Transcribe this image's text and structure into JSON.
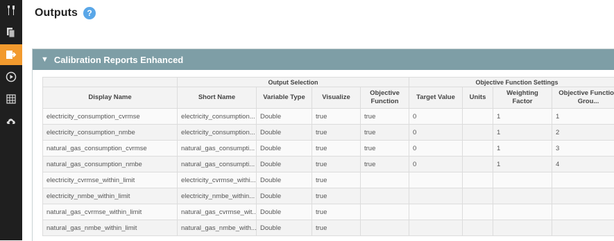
{
  "page": {
    "title": "Outputs",
    "help_icon": "?"
  },
  "sidebar": {
    "items": [
      {
        "icon": "tools-icon",
        "active": false
      },
      {
        "icon": "files-icon",
        "active": false
      },
      {
        "icon": "export-icon",
        "active": true
      },
      {
        "icon": "play-icon",
        "active": false
      },
      {
        "icon": "grid-icon",
        "active": false
      },
      {
        "icon": "cloud-icon",
        "active": false
      }
    ]
  },
  "panel": {
    "title": "Calibration Reports Enhanced",
    "group_output_selection": "Output Selection",
    "group_objective_settings": "Objective Function Settings",
    "columns": [
      "Display Name",
      "Short Name",
      "Variable Type",
      "Visualize",
      "Objective Function",
      "Target Value",
      "Units",
      "Weighting Factor",
      "Objective Function Grou..."
    ],
    "rows": [
      [
        "electricity_consumption_cvrmse",
        "electricity_consumption...",
        "Double",
        "true",
        "true",
        "0",
        "",
        "1",
        "1"
      ],
      [
        "electricity_consumption_nmbe",
        "electricity_consumption...",
        "Double",
        "true",
        "true",
        "0",
        "",
        "1",
        "2"
      ],
      [
        "natural_gas_consumption_cvrmse",
        "natural_gas_consumpti...",
        "Double",
        "true",
        "true",
        "0",
        "",
        "1",
        "3"
      ],
      [
        "natural_gas_consumption_nmbe",
        "natural_gas_consumpti...",
        "Double",
        "true",
        "true",
        "0",
        "",
        "1",
        "4"
      ],
      [
        "electricity_cvrmse_within_limit",
        "electricity_cvrmse_withi...",
        "Double",
        "true",
        "",
        "",
        "",
        "",
        ""
      ],
      [
        "electricity_nmbe_within_limit",
        "electricity_nmbe_within...",
        "Double",
        "true",
        "",
        "",
        "",
        "",
        ""
      ],
      [
        "natural_gas_cvrmse_within_limit",
        "natural_gas_cvrmse_wit...",
        "Double",
        "true",
        "",
        "",
        "",
        "",
        ""
      ],
      [
        "natural_gas_nmbe_within_limit",
        "natural_gas_nmbe_with...",
        "Double",
        "true",
        "",
        "",
        "",
        "",
        ""
      ]
    ]
  },
  "colors": {
    "sidebar_bg": "#1f1f1f",
    "sidebar_active": "#f29a2e",
    "panel_header_bg": "#7e9ea6",
    "help_icon_bg": "#5aa7e8"
  }
}
